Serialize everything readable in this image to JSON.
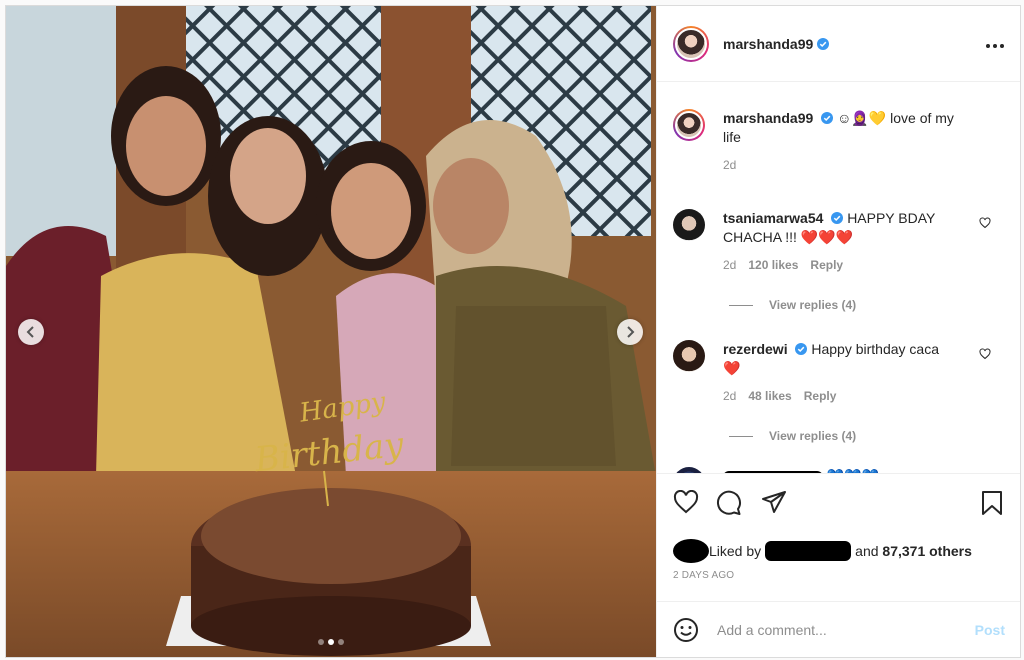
{
  "post": {
    "username": "marshanda99",
    "verified": true,
    "more_icon": "more-horizontal-icon",
    "photo_alt": "",
    "cake_topper": "Happy Birthday",
    "carousel": {
      "current_index": 1,
      "count": 3
    }
  },
  "caption": {
    "username": "marshanda99",
    "emojis": "☺🧕💛",
    "text": "love of my life",
    "time": "2d"
  },
  "comments": [
    {
      "username": "tsaniamarwa54",
      "text": "HAPPY BDAY CHACHA !!!",
      "hearts": "❤️❤️❤️",
      "time": "2d",
      "likes": "120 likes",
      "reply": "Reply",
      "view_replies": "View replies (4)"
    },
    {
      "username": "rezerdewi",
      "text": "Happy birthday caca",
      "hearts": "❤️",
      "time": "2d",
      "likes": "48 likes",
      "reply": "Reply",
      "view_replies": "View replies (4)"
    },
    {
      "username": "",
      "text": "",
      "hearts": "💙💙💙"
    }
  ],
  "likes": {
    "prefix": "Liked by",
    "and": "and",
    "count": "87,371 others"
  },
  "timestamp": "2 DAYS AGO",
  "add_comment": {
    "placeholder": "Add a comment...",
    "post_label": "Post"
  },
  "colors": {
    "accent": "#0095f6",
    "post_disabled": "#b2dffc",
    "heart": "#ed4956",
    "blue_heart": "#1da1f2"
  }
}
